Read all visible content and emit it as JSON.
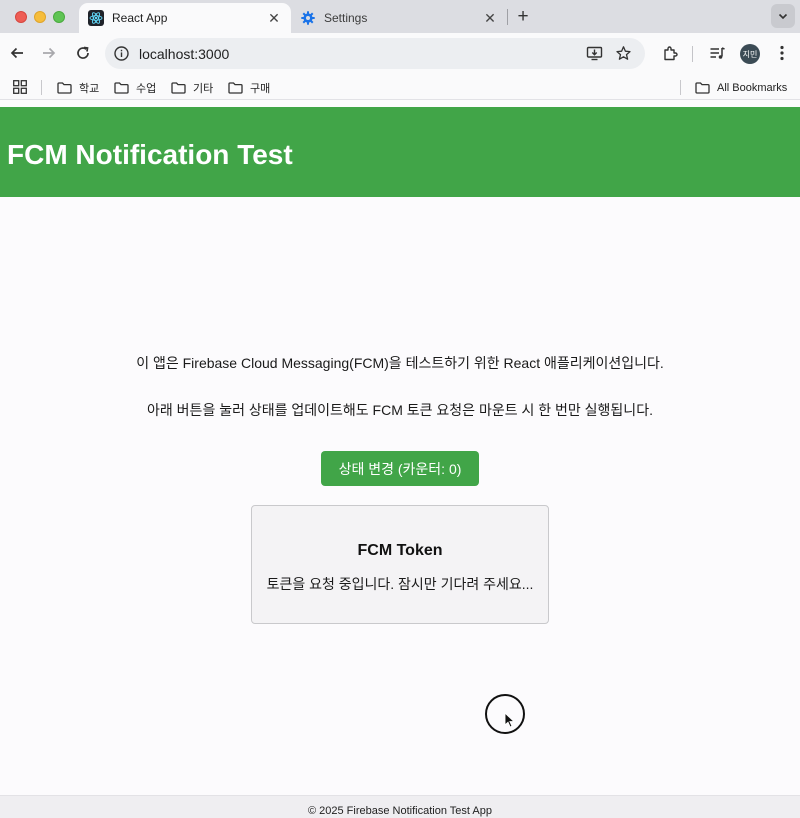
{
  "browser": {
    "tabs": [
      {
        "title": "React App",
        "active": true,
        "icon": "react-icon"
      },
      {
        "title": "Settings",
        "active": false,
        "icon": "gear-icon"
      }
    ],
    "address": "localhost:3000",
    "profile_initials": "지민",
    "bookmarks": [
      {
        "label": "학교",
        "icon": "folder-icon"
      },
      {
        "label": "수업",
        "icon": "folder-icon"
      },
      {
        "label": "기타",
        "icon": "folder-icon"
      },
      {
        "label": "구매",
        "icon": "folder-icon"
      }
    ],
    "all_bookmarks_label": "All Bookmarks"
  },
  "app": {
    "header_title": "FCM Notification Test",
    "header_color": "#41a548",
    "description_1": "이 앱은 Firebase Cloud Messaging(FCM)을 테스트하기 위한 React 애플리케이션입니다.",
    "description_2": "아래 버튼을 눌러 상태를 업데이트해도 FCM 토큰 요청은 마운트 시 한 번만 실행됩니다.",
    "counter_button_label": "상태 변경 (카운터: 0)",
    "token_card": {
      "title": "FCM Token",
      "status": "토큰을 요청 중입니다. 잠시만 기다려 주세요..."
    },
    "footer": "© 2025 Firebase Notification Test App"
  }
}
